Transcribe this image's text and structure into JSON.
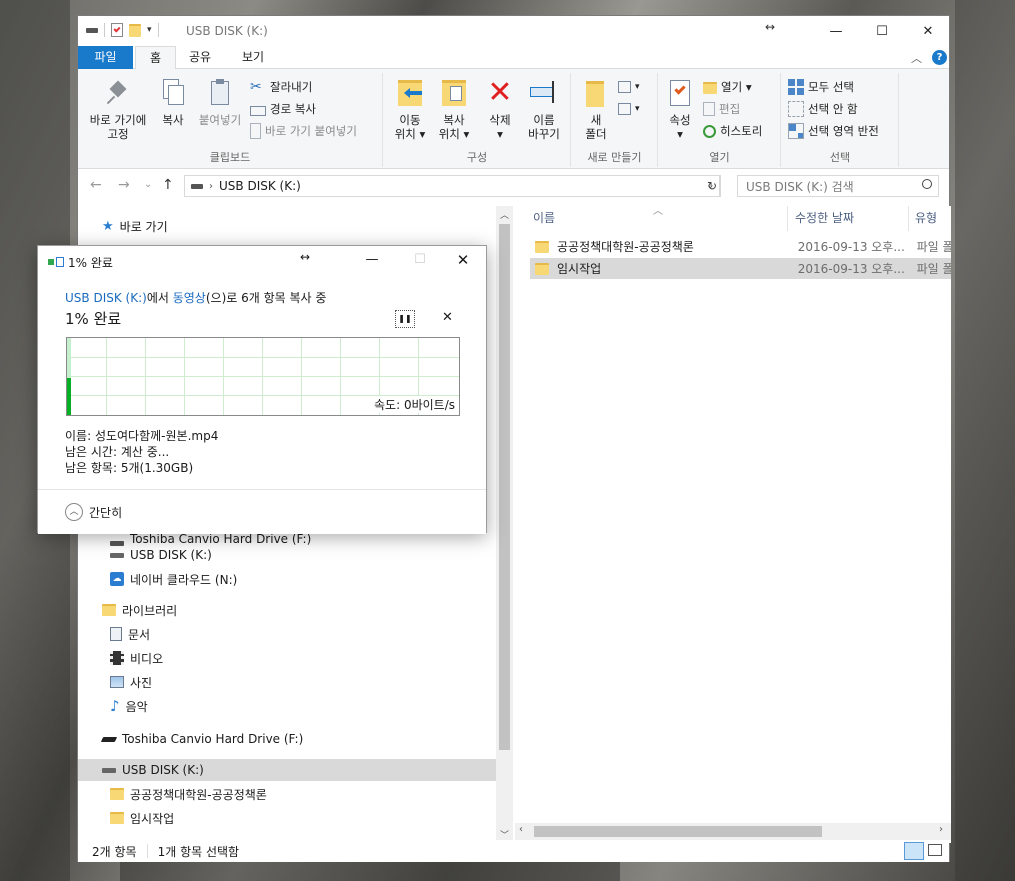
{
  "explorer": {
    "title": "USB DISK (K:)",
    "resize_glyph": "↔",
    "window_buttons": [
      "—",
      "☐",
      "✕"
    ],
    "tabs": [
      {
        "label": "파일"
      },
      {
        "label": "홈"
      },
      {
        "label": "공유"
      },
      {
        "label": "보기"
      }
    ],
    "ribbon": {
      "clipboard": {
        "label": "클립보드",
        "pin": "바로 가기에\n고정",
        "copy": "복사",
        "paste": "붙여넣기",
        "cut": "잘라내기",
        "copy_path": "경로 복사",
        "paste_shortcut": "바로 가기 붙여넣기"
      },
      "organize": {
        "label": "구성",
        "move_to": "이동\n위치 ▾",
        "copy_to": "복사\n위치 ▾",
        "delete": "삭제\n▾",
        "rename": "이름\n바꾸기"
      },
      "new": {
        "label": "새로 만들기",
        "new_folder": "새\n폴더"
      },
      "open": {
        "label": "열기",
        "properties": "속성\n▾",
        "open": "열기 ▾",
        "edit": "편집",
        "history": "히스토리"
      },
      "select": {
        "label": "선택",
        "select_all": "모두 선택",
        "select_none": "선택 안 함",
        "invert": "선택 영역 반전"
      }
    },
    "address": {
      "path": "USB DISK (K:)",
      "search_placeholder": "USB DISK (K:) 검색"
    },
    "nav": {
      "quick_access": "바로 가기",
      "hidden_drive": "Toshiba Canvio Hard Drive (F:)",
      "usb": "USB DISK (K:)",
      "naver": "네이버 클라우드 (N:)",
      "libraries": "라이브러리",
      "documents": "문서",
      "videos": "비디오",
      "pictures": "사진",
      "music": "음악",
      "toshiba": "Toshiba Canvio Hard Drive (F:)",
      "usb2": "USB DISK (K:)",
      "folder1": "공공정책대학원-공공정책론",
      "folder2": "임시작업"
    },
    "columns": {
      "name": "이름",
      "modified": "수정한 날짜",
      "type": "유형"
    },
    "files": [
      {
        "name": "공공정책대학원-공공정책론",
        "modified": "2016-09-13 오후...",
        "type": "파일 폴"
      },
      {
        "name": "임시작업",
        "modified": "2016-09-13 오후...",
        "type": "파일 폴"
      }
    ],
    "status": {
      "count": "2개 항목",
      "selected": "1개 항목 선택함"
    }
  },
  "dialog": {
    "title": "1% 완료",
    "resize_glyph": "↔",
    "source_prefix": "USB DISK (K:)",
    "source_mid": "에서 ",
    "dest": "동영상",
    "source_suffix": "(으)로 6개 항목 복사 중",
    "progress_text": "1% 완료",
    "progress_percent": 1,
    "speed": "속도: 0바이트/s",
    "name_line": "이름: 성도여다함께-원본.mp4",
    "time_line": "남은 시간: 계산 중...",
    "items_line": "남은 항목: 5개(1.30GB)",
    "less_details": "간단히",
    "pause_glyph": "❚❚",
    "cancel_glyph": "✕"
  },
  "colors": {
    "file_tab": "#1979ca",
    "link_blue": "#1a6bbf",
    "progress_green": "#06b025",
    "selection": "#d9d9d9"
  }
}
